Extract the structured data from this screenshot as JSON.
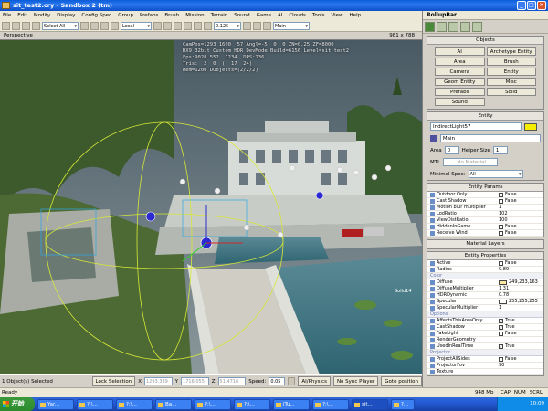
{
  "window": {
    "title": "sit_test2.cry - Sandbox 2 (tm)"
  },
  "menu": [
    "File",
    "Edit",
    "Modify",
    "Display",
    "Config Spec",
    "Group",
    "Prefabs",
    "Brush",
    "Mission",
    "Terrain",
    "Sound",
    "Game",
    "AI",
    "Clouds",
    "Tools",
    "View",
    "Help"
  ],
  "toolbar": {
    "select_mode": "Select All",
    "coord_system": "Local",
    "snap_value": "0.125",
    "layer": "Main"
  },
  "viewport": {
    "label": "Perspective",
    "resolution": "981 x 788",
    "hud_lines": [
      "CamPos=1293 1690  57 Angl=-5  0  0 ZN=0.25 ZF=8000",
      "DX9 32bit Custom HDR DevMode Build=6156 Level=sit test2",
      "Fps:9028.552  1234  DPS:236",
      "Tris:  2  0  (  17  24)",
      "Mem=1200 DObjects=(2/2/2)"
    ],
    "object_label": "Solid14"
  },
  "rollup": {
    "title": "RollupBar",
    "objects": {
      "header": "Objects",
      "buttons": [
        "AI",
        "Archetype Entity",
        "Area",
        "Brush",
        "Camera",
        "Entity",
        "Geom Entity",
        "Misc",
        "Prefabs",
        "Solid",
        "Sound"
      ]
    },
    "entity": {
      "header": "Entity",
      "name": "IndirectLight57",
      "color": "#f5ee00",
      "layer": "Main",
      "area_label": "Area",
      "area_value": "0",
      "helper_label": "Helper Size",
      "helper_value": "1",
      "mtl_label": "MTL",
      "mtl_value": "No Material",
      "minspec_label": "Minimal Spec:",
      "minspec_value": "All"
    },
    "entity_params": {
      "header": "Entity Params",
      "rows": [
        {
          "name": "Outdoor Only",
          "check": "",
          "value": "False"
        },
        {
          "name": "Cast Shadow",
          "check": "",
          "value": "False"
        },
        {
          "name": "Motion blur multiplier",
          "check": "",
          "value": "1"
        },
        {
          "name": "LodRatio",
          "check": "",
          "value": "102"
        },
        {
          "name": "ViewDistRatio",
          "check": "",
          "value": "100"
        },
        {
          "name": "HiddenInGame",
          "check": "",
          "value": "False"
        },
        {
          "name": "Receive Wind",
          "check": "",
          "value": "False"
        }
      ]
    },
    "material_layers": {
      "header": "Material Layers"
    },
    "entity_properties": {
      "header": "Entity Properties",
      "rows": [
        {
          "name": "Active",
          "check": "",
          "value": "False"
        },
        {
          "name": "Radius",
          "value": "9.89"
        }
      ],
      "color_group": "Color",
      "color_rows": [
        {
          "name": "Diffuse",
          "swatch": "#f9e9a0",
          "value": "249,233,163"
        },
        {
          "name": "DiffuseMultiplier",
          "value": "1.31"
        },
        {
          "name": "HDRDynamic",
          "value": "0.78"
        },
        {
          "name": "Specular",
          "swatch": "#ffffff",
          "value": "255,255,255"
        },
        {
          "name": "SpecularMultiplier",
          "value": "1"
        }
      ],
      "options_group": "Options",
      "options_rows": [
        {
          "name": "AffectsThisAreaOnly",
          "check": "✓",
          "value": "True"
        },
        {
          "name": "CastShadow",
          "check": "✓",
          "value": "True"
        },
        {
          "name": "FakeLight",
          "check": "",
          "value": "False"
        },
        {
          "name": "RenderGeometry",
          "value": ""
        },
        {
          "name": "UsedInRealTime",
          "check": "✓",
          "value": "True"
        }
      ],
      "projector_group": "Projector",
      "projector_rows": [
        {
          "name": "ProjectAllSides",
          "check": "",
          "value": "False"
        },
        {
          "name": "ProjectorFov",
          "value": "90"
        },
        {
          "name": "Texture",
          "value": ""
        }
      ]
    }
  },
  "bottombar": {
    "selection": "1 Object(s) Selected",
    "lock": "Lock Selection",
    "x_label": "X",
    "x_value": "1293.339",
    "y_label": "Y",
    "y_value": "1716.055",
    "z_label": "Z",
    "z_value": "51.4716",
    "speed_label": "Speed:",
    "speed_value": "0.05",
    "ai_physics": "AI/Physics",
    "sync": "No Sync Player",
    "goto": "Goto position"
  },
  "statusbar": {
    "text": "Ready",
    "mem": "948 Mb",
    "caps": [
      "CAP",
      "NUM",
      "SCRL"
    ]
  },
  "taskbar": {
    "start": "开始",
    "tasks": [
      "Yar...",
      "?:\\...",
      "?:\\...",
      "Ba...",
      "?:\\...",
      "?:\\...",
      "iTu...",
      "?:\\...",
      "sit...",
      "?..."
    ],
    "clock": "10:09"
  }
}
